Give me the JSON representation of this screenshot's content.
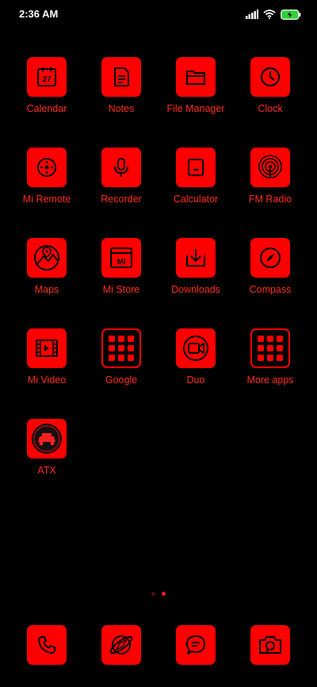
{
  "status": {
    "time": "2:36 AM"
  },
  "apps": [
    {
      "label": "Calendar",
      "icon": "calendar-icon",
      "date": "27"
    },
    {
      "label": "Notes",
      "icon": "notes-icon"
    },
    {
      "label": "File Manager",
      "icon": "folder-icon"
    },
    {
      "label": "Clock",
      "icon": "clock-icon"
    },
    {
      "label": "Mi Remote",
      "icon": "remote-icon"
    },
    {
      "label": "Recorder",
      "icon": "microphone-icon"
    },
    {
      "label": "Calculator",
      "icon": "calculator-icon"
    },
    {
      "label": "FM Radio",
      "icon": "radio-icon"
    },
    {
      "label": "Maps",
      "icon": "map-icon"
    },
    {
      "label": "Mi Store",
      "icon": "store-icon",
      "logo": "MI"
    },
    {
      "label": "Downloads",
      "icon": "download-icon"
    },
    {
      "label": "Compass",
      "icon": "compass-icon"
    },
    {
      "label": "Mi Video",
      "icon": "video-icon"
    },
    {
      "label": "Google",
      "icon": "folder-grid-icon"
    },
    {
      "label": "Duo",
      "icon": "duo-video-icon"
    },
    {
      "label": "More apps",
      "icon": "folder-grid-icon"
    },
    {
      "label": "ATX",
      "icon": "atx-logo-icon"
    }
  ],
  "dock": [
    {
      "icon": "phone-icon"
    },
    {
      "icon": "browser-icon"
    },
    {
      "icon": "message-icon"
    },
    {
      "icon": "camera-icon"
    }
  ],
  "pages": {
    "count": 2,
    "active": 2
  },
  "colors": {
    "accent": "#ff0000",
    "label": "#ff2b1a",
    "background": "#000000"
  }
}
